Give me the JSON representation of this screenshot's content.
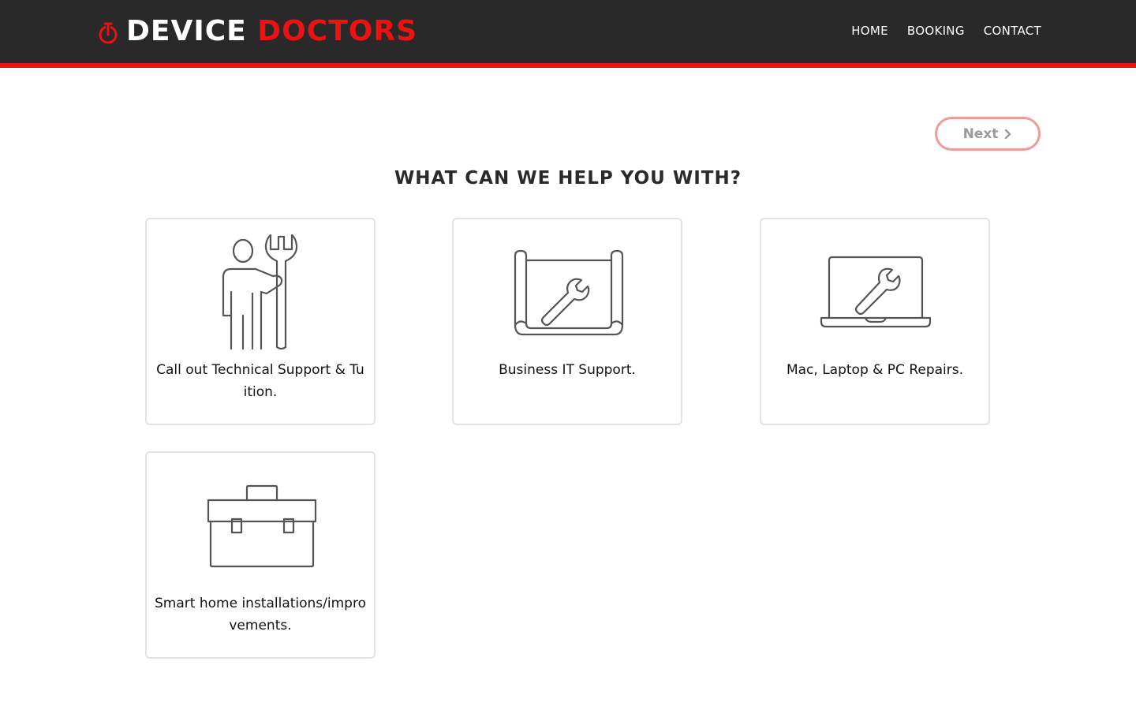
{
  "header": {
    "brand_word1": "DEVICE",
    "brand_word2": "DOCTORS",
    "brand_icon": "power-icon",
    "nav": [
      {
        "label": "HOME"
      },
      {
        "label": "BOOKING"
      },
      {
        "label": "CONTACT"
      }
    ]
  },
  "next_button": {
    "label": "Next",
    "icon": "chevron-right-icon"
  },
  "page_title": "WHAT CAN WE HELP YOU WITH?",
  "services": [
    {
      "label": "Call out Technical Support & Tuition.",
      "icon": "technician-wrench-icon"
    },
    {
      "label": "Business IT Support.",
      "icon": "blueprint-wrench-icon"
    },
    {
      "label": "Mac, Laptop & PC Repairs.",
      "icon": "laptop-wrench-icon"
    },
    {
      "label": "Smart home installations/improvements.",
      "icon": "toolbox-icon"
    }
  ],
  "colors": {
    "header_bg": "#292929",
    "accent_red": "#ee1111",
    "next_border": "#f29a9a",
    "card_border": "#e3e3e3",
    "icon_stroke": "#555555"
  }
}
